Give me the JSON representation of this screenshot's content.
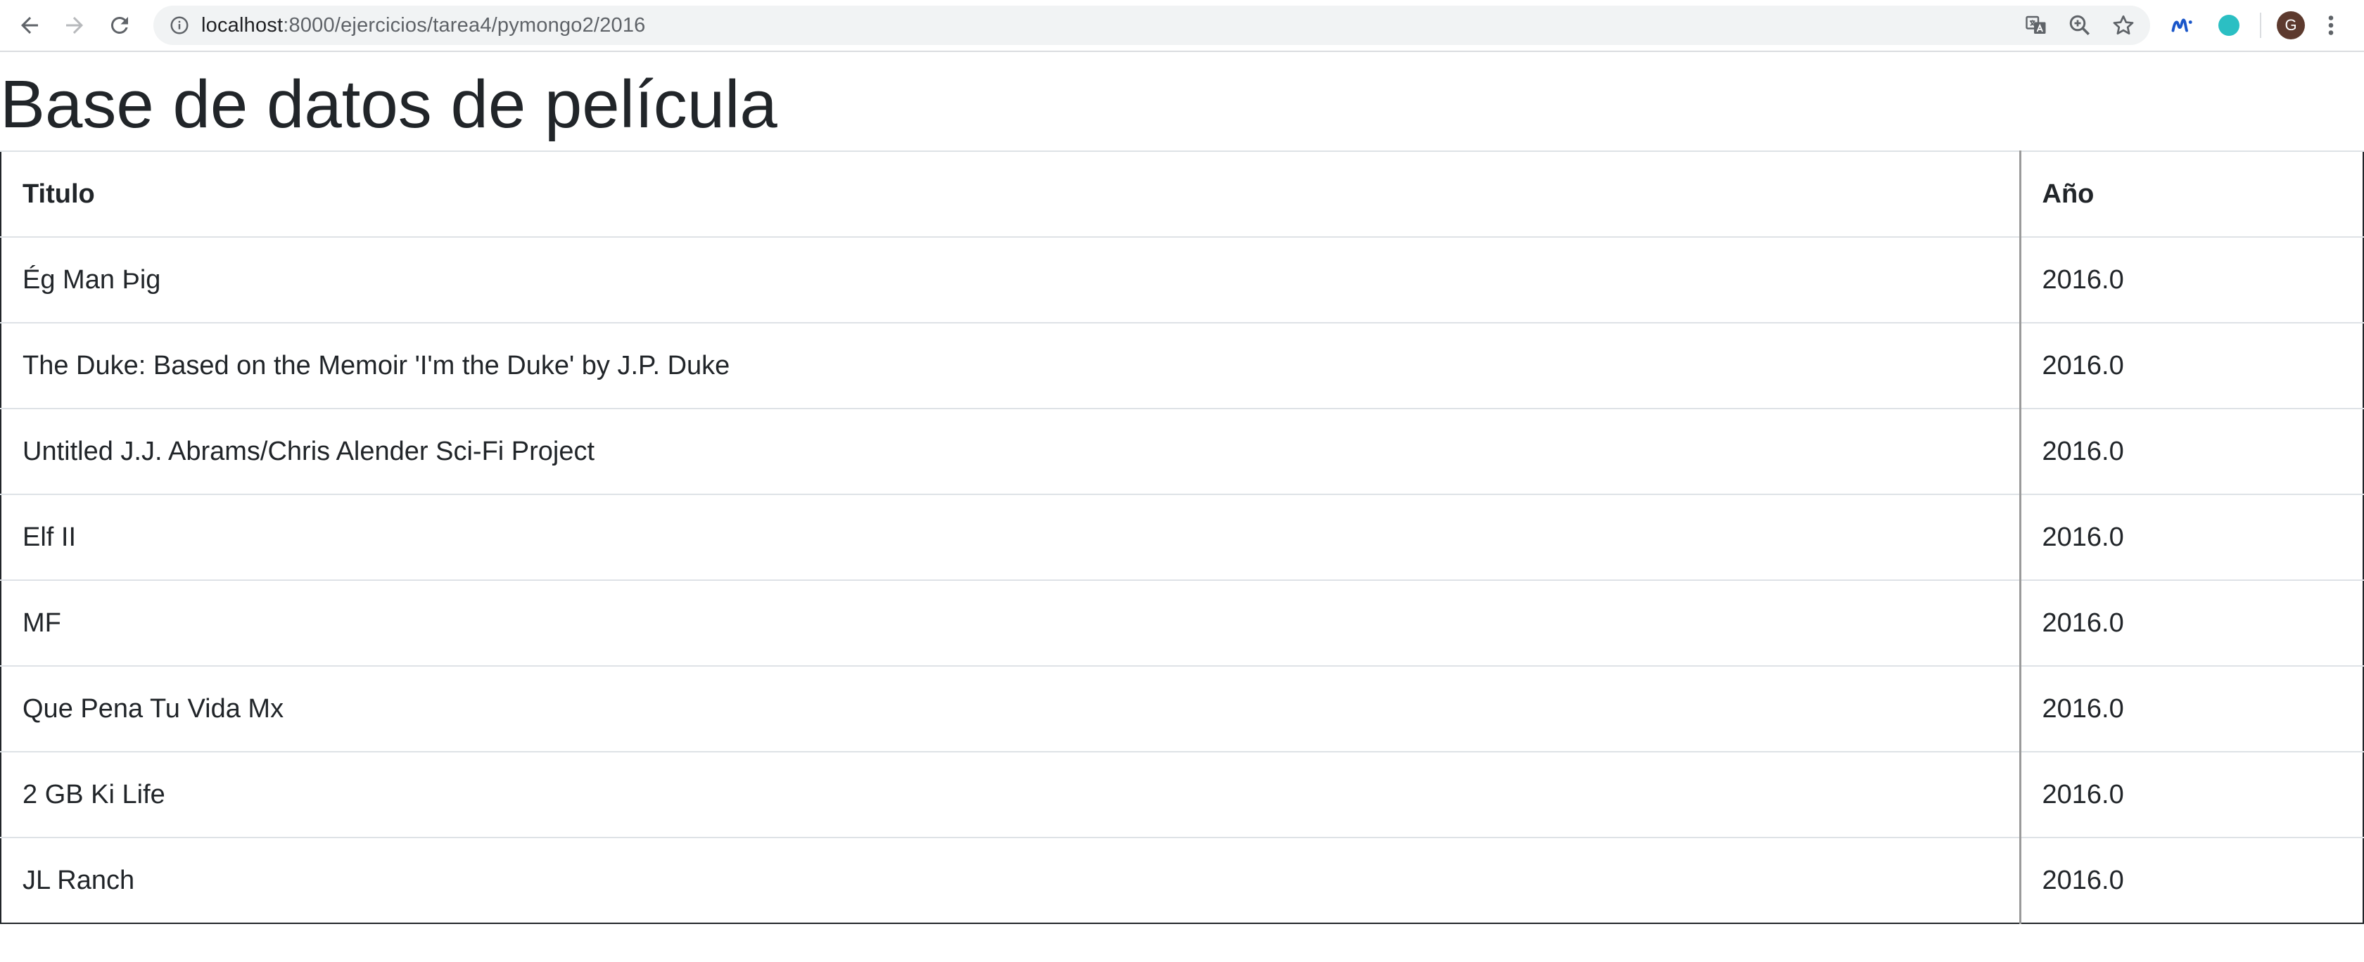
{
  "browser": {
    "url_host": "localhost",
    "url_path": ":8000/ejercicios/tarea4/pymongo2/2016",
    "avatar_initial": "G",
    "icons": [
      "back-icon",
      "forward-icon",
      "reload-icon",
      "info-icon",
      "translate-icon",
      "zoom-icon",
      "star-icon",
      "movistar-extension-icon",
      "teal-extension-icon",
      "menu-icon"
    ],
    "colors": {
      "teal_extension": "#2bbfc3",
      "avatar_bg": "#5d3a2e",
      "movistar_blue": "#1a56c9"
    }
  },
  "page": {
    "title": "Base de datos de película"
  },
  "table": {
    "headers": {
      "title": "Titulo",
      "year": "Año"
    },
    "rows": [
      {
        "title": "Ég Man Þig",
        "year": "2016.0"
      },
      {
        "title": "The Duke: Based on the Memoir 'I'm the Duke' by J.P. Duke",
        "year": "2016.0"
      },
      {
        "title": "Untitled J.J. Abrams/Chris Alender Sci-Fi Project",
        "year": "2016.0"
      },
      {
        "title": "Elf II",
        "year": "2016.0"
      },
      {
        "title": "MF",
        "year": "2016.0"
      },
      {
        "title": "Que Pena Tu Vida Mx",
        "year": "2016.0"
      },
      {
        "title": "2 GB Ki Life",
        "year": "2016.0"
      },
      {
        "title": "JL Ranch",
        "year": "2016.0"
      }
    ]
  }
}
